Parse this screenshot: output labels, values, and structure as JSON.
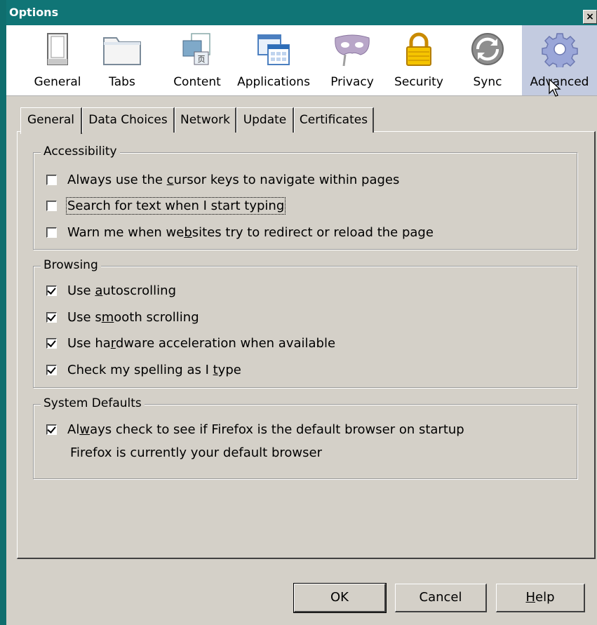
{
  "window": {
    "title": "Options",
    "close_glyph": "×"
  },
  "panes": [
    {
      "label": "General",
      "icon": "general-icon"
    },
    {
      "label": "Tabs",
      "icon": "tabs-icon"
    },
    {
      "label": "Content",
      "icon": "content-icon"
    },
    {
      "label": "Applications",
      "icon": "applications-icon"
    },
    {
      "label": "Privacy",
      "icon": "privacy-mask-icon"
    },
    {
      "label": "Security",
      "icon": "padlock-icon"
    },
    {
      "label": "Sync",
      "icon": "sync-icon"
    },
    {
      "label": "Advanced",
      "icon": "gear-icon",
      "selected": true
    }
  ],
  "tabs": [
    {
      "label": "General",
      "active": true
    },
    {
      "label": "Data Choices"
    },
    {
      "label": "Network"
    },
    {
      "label": "Update"
    },
    {
      "label": "Certificates"
    }
  ],
  "groups": {
    "accessibility": {
      "legend": "Accessibility",
      "options": [
        {
          "pre": "Always use the ",
          "u": "c",
          "post": "ursor keys to navigate within pages",
          "checked": false
        },
        {
          "pre": "Search for text when I start typ",
          "u": "",
          "post": "",
          "full": "Search for text when I start typing",
          "checked": false,
          "focused": true
        },
        {
          "pre": "Warn me when we",
          "u": "b",
          "post": "sites try to redirect or reload the page",
          "checked": false
        }
      ]
    },
    "browsing": {
      "legend": "Browsing",
      "options": [
        {
          "pre": "Use ",
          "u": "a",
          "post": "utoscrolling",
          "checked": true
        },
        {
          "pre": "Use s",
          "u": "m",
          "post": "ooth scrolling",
          "checked": true
        },
        {
          "pre": "Use ha",
          "u": "r",
          "post": "dware acceleration when available",
          "checked": true
        },
        {
          "pre": "Check my spelling as I ",
          "u": "t",
          "post": "ype",
          "checked": true
        }
      ]
    },
    "system_defaults": {
      "legend": "System Defaults",
      "options": [
        {
          "pre": "Al",
          "u": "w",
          "post": "ays check to see if Firefox is the default browser on startup",
          "checked": true
        }
      ],
      "status": "Firefox is currently your default browser"
    }
  },
  "buttons": {
    "ok": "OK",
    "cancel": "Cancel",
    "help_u": "H",
    "help_rest": "elp"
  },
  "colors": {
    "titlebar": "#107576",
    "dialog_bg": "#d4d0c8",
    "selected_pane": "#c3cbe0"
  }
}
